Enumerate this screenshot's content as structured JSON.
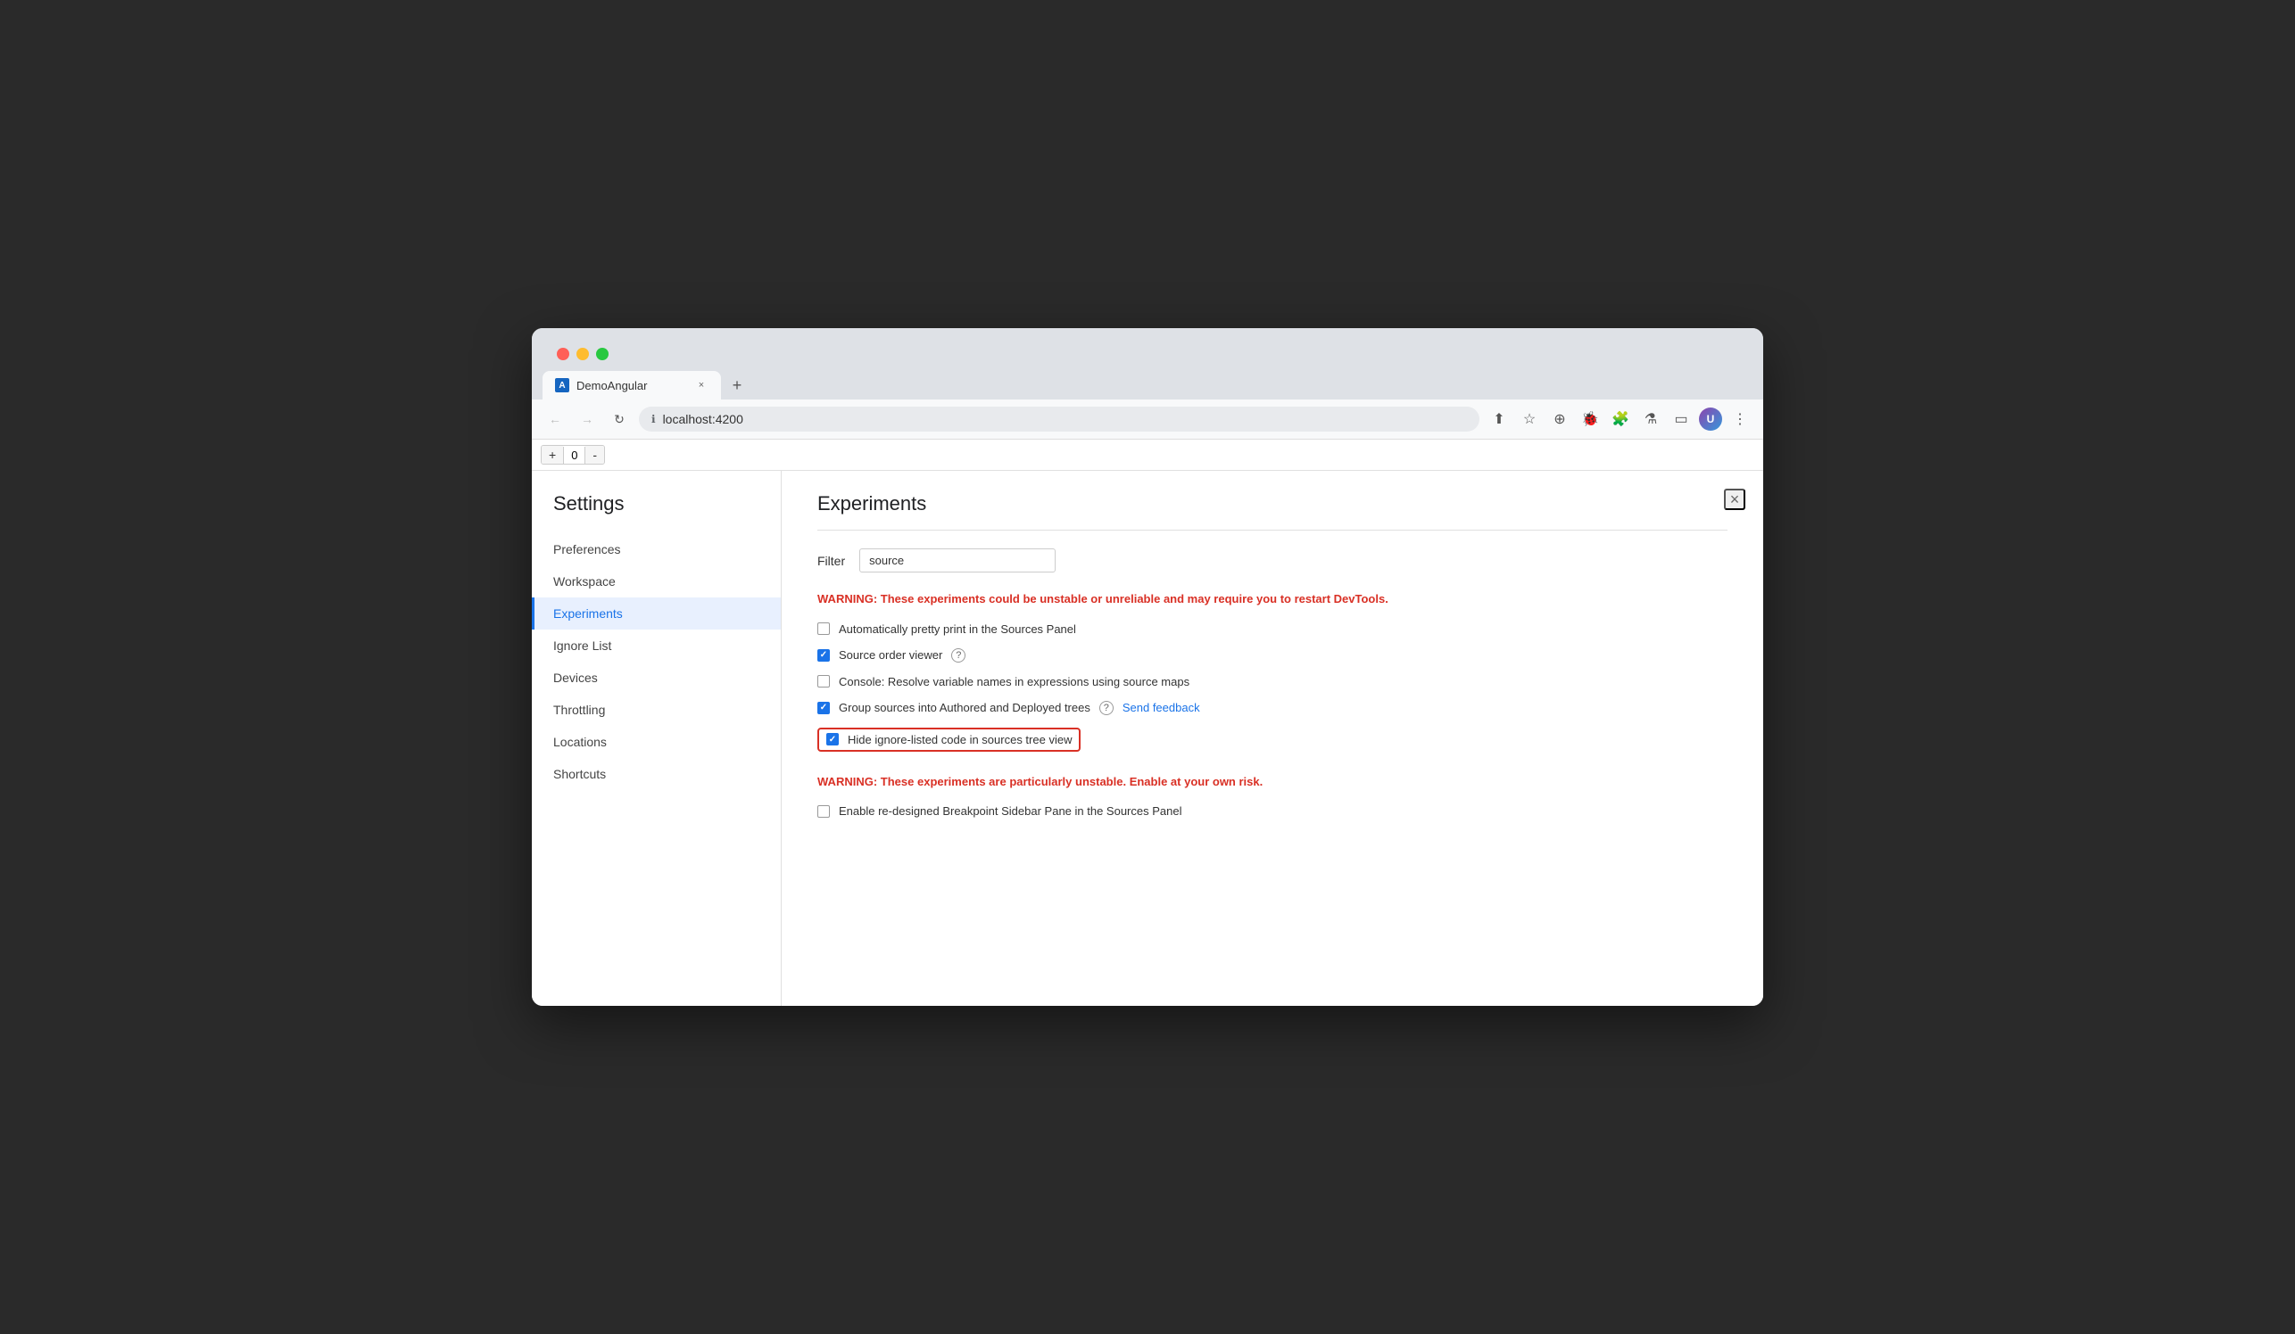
{
  "browser": {
    "tab": {
      "favicon": "A",
      "title": "DemoAngular",
      "close_label": "×",
      "new_tab_label": "+"
    },
    "address": "localhost:4200",
    "nav": {
      "back": "←",
      "forward": "→",
      "reload": "↻",
      "more": "⋮"
    },
    "toolbar_icons": {
      "share": "⬆",
      "star": "☆",
      "earth": "⊕",
      "bug": "🐞",
      "puzzle": "🧩",
      "lab": "⚗",
      "sidebar": "▭",
      "profile": "U"
    }
  },
  "devtools": {
    "counter": {
      "plus": "+",
      "value": "0",
      "minus": "-"
    }
  },
  "settings": {
    "title": "Settings",
    "close_label": "×",
    "nav_items": [
      {
        "id": "preferences",
        "label": "Preferences",
        "active": false
      },
      {
        "id": "workspace",
        "label": "Workspace",
        "active": false
      },
      {
        "id": "experiments",
        "label": "Experiments",
        "active": true
      },
      {
        "id": "ignore-list",
        "label": "Ignore List",
        "active": false
      },
      {
        "id": "devices",
        "label": "Devices",
        "active": false
      },
      {
        "id": "throttling",
        "label": "Throttling",
        "active": false
      },
      {
        "id": "locations",
        "label": "Locations",
        "active": false
      },
      {
        "id": "shortcuts",
        "label": "Shortcuts",
        "active": false
      }
    ],
    "experiments": {
      "section_title": "Experiments",
      "filter_label": "Filter",
      "filter_value": "source",
      "warning1": "These experiments could be unstable or unreliable and may require you to restart DevTools.",
      "warning1_prefix": "WARNING:",
      "options": [
        {
          "id": "pretty-print",
          "label": "Automatically pretty print in the Sources Panel",
          "checked": false,
          "highlighted": false,
          "has_help": false,
          "has_feedback": false
        },
        {
          "id": "source-order",
          "label": "Source order viewer",
          "checked": true,
          "highlighted": false,
          "has_help": true,
          "has_feedback": false
        },
        {
          "id": "resolve-variables",
          "label": "Console: Resolve variable names in expressions using source maps",
          "checked": false,
          "highlighted": false,
          "has_help": false,
          "has_feedback": false
        },
        {
          "id": "group-sources",
          "label": "Group sources into Authored and Deployed trees",
          "checked": true,
          "highlighted": false,
          "has_help": true,
          "has_feedback": true,
          "feedback_label": "Send feedback"
        },
        {
          "id": "hide-ignore-listed",
          "label": "Hide ignore-listed code in sources tree view",
          "checked": true,
          "highlighted": true,
          "has_help": false,
          "has_feedback": false
        }
      ],
      "warning2": "These experiments are particularly unstable. Enable at your own risk.",
      "warning2_prefix": "WARNING:",
      "unstable_options": [
        {
          "id": "breakpoint-sidebar",
          "label": "Enable re-designed Breakpoint Sidebar Pane in the Sources Panel",
          "checked": false
        }
      ]
    }
  }
}
